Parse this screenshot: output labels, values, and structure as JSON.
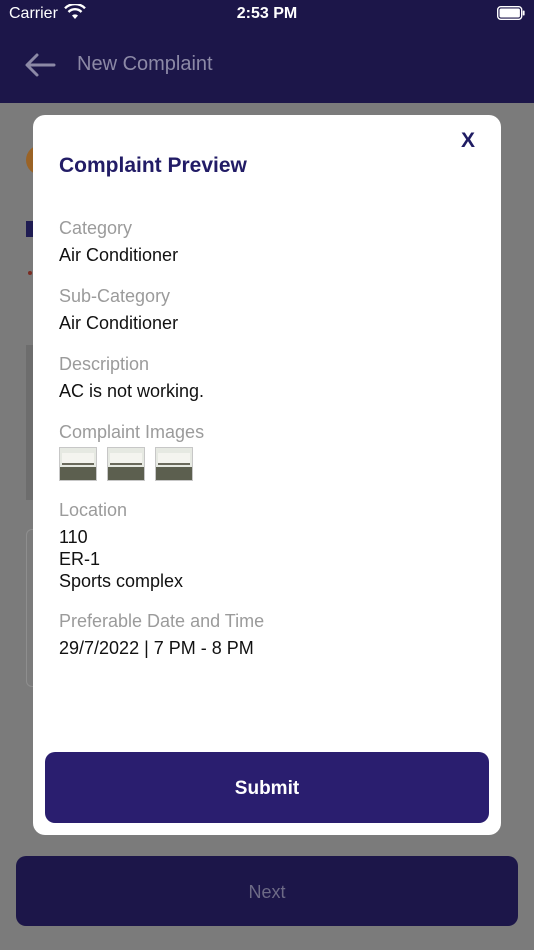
{
  "status_bar": {
    "carrier": "Carrier",
    "time": "2:53 PM"
  },
  "header": {
    "title": "New Complaint"
  },
  "footer": {
    "next_label": "Next"
  },
  "modal": {
    "title": "Complaint Preview",
    "close_label": "X",
    "category": {
      "label": "Category",
      "value": "Air Conditioner"
    },
    "sub_category": {
      "label": "Sub-Category",
      "value": "Air Conditioner"
    },
    "description": {
      "label": "Description",
      "value": "AC is not working."
    },
    "images": {
      "label": "Complaint Images",
      "count": 3
    },
    "location": {
      "label": "Location",
      "lines": [
        "110",
        "ER-1",
        "Sports complex"
      ]
    },
    "preferable": {
      "label": "Preferable Date and Time",
      "value": "29/7/2022 | 7 PM - 8 PM"
    },
    "submit_label": "Submit"
  },
  "colors": {
    "brand": "#1c1649",
    "accent": "#2a1e6f",
    "label": "#9b9b9b"
  },
  "icons": [
    "wifi-icon",
    "battery-icon",
    "back-arrow-icon",
    "close-icon"
  ]
}
